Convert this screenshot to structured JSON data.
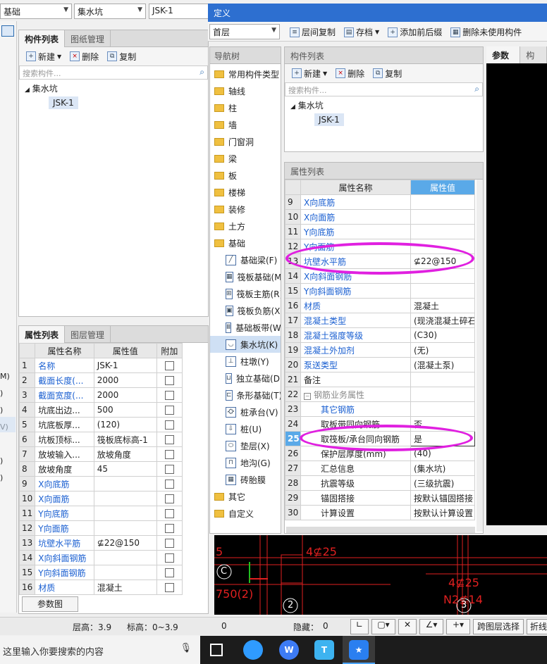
{
  "top_combos": {
    "c1": "基础",
    "c2": "集水坑",
    "c3": "JSK-1"
  },
  "dialog": {
    "title": "定义",
    "floor": "首层",
    "toolbar": [
      "层间复制",
      "存档",
      "添加前后缀",
      "删除未使用构件"
    ]
  },
  "left_comp": {
    "tabs": [
      "构件列表",
      "图纸管理"
    ],
    "toolbar": {
      "new": "新建",
      "delete": "删除",
      "copy": "复制"
    },
    "search_placeholder": "搜索构件...",
    "tree": {
      "root": "集水坑",
      "child": "JSK-1"
    }
  },
  "left_props": {
    "tabs": [
      "属性列表",
      "图层管理"
    ],
    "headers": [
      "属性名称",
      "属性值",
      "附加"
    ],
    "rows": [
      {
        "n": "1",
        "name": "名称",
        "val": "JSK-1",
        "blue": true
      },
      {
        "n": "2",
        "name": "截面长度(...",
        "val": "2000",
        "blue": true
      },
      {
        "n": "3",
        "name": "截面宽度(...",
        "val": "2000",
        "blue": true
      },
      {
        "n": "4",
        "name": "坑底出边...",
        "val": "500",
        "blue": false
      },
      {
        "n": "5",
        "name": "坑底板厚...",
        "val": "(120)",
        "blue": false
      },
      {
        "n": "6",
        "name": "坑板顶标...",
        "val": "筏板底标高-1",
        "blue": false
      },
      {
        "n": "7",
        "name": "放坡输入...",
        "val": "放坡角度",
        "blue": false
      },
      {
        "n": "8",
        "name": "放坡角度",
        "val": "45",
        "blue": false
      },
      {
        "n": "9",
        "name": "X向底筋",
        "val": "",
        "blue": true
      },
      {
        "n": "10",
        "name": "X向面筋",
        "val": "",
        "blue": true
      },
      {
        "n": "11",
        "name": "Y向底筋",
        "val": "",
        "blue": true
      },
      {
        "n": "12",
        "name": "Y向面筋",
        "val": "",
        "blue": true
      },
      {
        "n": "13",
        "name": "坑壁水平筋",
        "val": "⊈22@150",
        "blue": true
      },
      {
        "n": "14",
        "name": "X向斜面钢筋",
        "val": "",
        "blue": true
      },
      {
        "n": "15",
        "name": "Y向斜面钢筋",
        "val": "",
        "blue": true
      },
      {
        "n": "16",
        "name": "材质",
        "val": "混凝土",
        "blue": true
      }
    ],
    "button": "参数图"
  },
  "left_edge_letters": [
    "M)",
    ")",
    ")",
    "V)",
    ")",
    ")"
  ],
  "nav": {
    "header": "导航树",
    "folders": [
      "常用构件类型",
      "轴线",
      "柱",
      "墙",
      "门窗洞",
      "梁",
      "板",
      "楼梯",
      "装修",
      "土方",
      "基础"
    ],
    "sub": [
      "基础梁(F)",
      "筏板基础(M)",
      "筏板主筋(R)",
      "筏板负筋(X)",
      "基础板带(W)",
      "集水坑(K)",
      "柱墩(Y)",
      "独立基础(D)",
      "条形基础(T)",
      "桩承台(V)",
      "桩(U)",
      "垫层(X)",
      "地沟(G)",
      "砖胎膜"
    ],
    "after": [
      "其它",
      "自定义"
    ]
  },
  "mid_comp": {
    "header": "构件列表",
    "toolbar": {
      "new": "新建",
      "delete": "删除",
      "copy": "复制"
    },
    "search_placeholder": "搜索构件...",
    "tree": {
      "root": "集水坑",
      "child": "JSK-1"
    }
  },
  "mid_props": {
    "header": "属性列表",
    "headers": [
      "属性名称",
      "属性值"
    ],
    "rows": [
      {
        "n": "9",
        "name": "X向底筋",
        "val": "",
        "blue": true
      },
      {
        "n": "10",
        "name": "X向面筋",
        "val": "",
        "blue": true
      },
      {
        "n": "11",
        "name": "Y向底筋",
        "val": "",
        "blue": true
      },
      {
        "n": "12",
        "name": "Y向面筋",
        "val": "",
        "blue": true
      },
      {
        "n": "13",
        "name": "坑壁水平筋",
        "val": "⊈22@150",
        "blue": true
      },
      {
        "n": "14",
        "name": "X向斜面钢筋",
        "val": "",
        "blue": true
      },
      {
        "n": "15",
        "name": "Y向斜面钢筋",
        "val": "",
        "blue": true
      },
      {
        "n": "16",
        "name": "材质",
        "val": "混凝土",
        "blue": true
      },
      {
        "n": "17",
        "name": "混凝土类型",
        "val": "(现浇混凝土碎石",
        "blue": true
      },
      {
        "n": "18",
        "name": "混凝土强度等级",
        "val": "(C30)",
        "blue": true
      },
      {
        "n": "19",
        "name": "混凝土外加剂",
        "val": "(无)",
        "blue": true
      },
      {
        "n": "20",
        "name": "泵送类型",
        "val": "(混凝土泵)",
        "blue": true
      },
      {
        "n": "21",
        "name": "备注",
        "val": "",
        "blue": false
      },
      {
        "n": "22",
        "name": "钢筋业务属性",
        "val": "",
        "blue": false,
        "group": true
      },
      {
        "n": "23",
        "name": "其它钢筋",
        "val": "",
        "blue": true,
        "indent": true
      },
      {
        "n": "24",
        "name": "取板带同向钢筋",
        "val": "否",
        "blue": false,
        "indent": true
      },
      {
        "n": "25",
        "name": "取筏板/承台同向钢筋",
        "val": "是",
        "blue": false,
        "indent": true,
        "sel": true
      },
      {
        "n": "26",
        "name": "保护层厚度(mm)",
        "val": "(40)",
        "blue": false,
        "indent": true
      },
      {
        "n": "27",
        "name": "汇总信息",
        "val": "(集水坑)",
        "blue": false,
        "indent": true
      },
      {
        "n": "28",
        "name": "抗震等级",
        "val": "(三级抗震)",
        "blue": false,
        "indent": true
      },
      {
        "n": "29",
        "name": "锚固搭接",
        "val": "按默认锚固搭接",
        "blue": false,
        "indent": true
      },
      {
        "n": "30",
        "name": "计算设置",
        "val": "按默认计算设置",
        "blue": false,
        "indent": true
      }
    ]
  },
  "right_tabs": [
    "参数图",
    "构件"
  ],
  "cad": {
    "labels": [
      "4⊈25",
      "4⊈25",
      "N2⊈14",
      "750(2)",
      "5"
    ],
    "markers": [
      "C",
      "2",
      "3"
    ]
  },
  "status": {
    "floor_height": "层高：3.9",
    "elev": "标高：0~3.9",
    "zero": "0",
    "hidden": "隐藏：",
    "hidden_val": "0",
    "btn_cross": "跨图层选择",
    "btn_line": "折线"
  },
  "taskbar": {
    "search": "这里输入你要搜索的内容"
  }
}
